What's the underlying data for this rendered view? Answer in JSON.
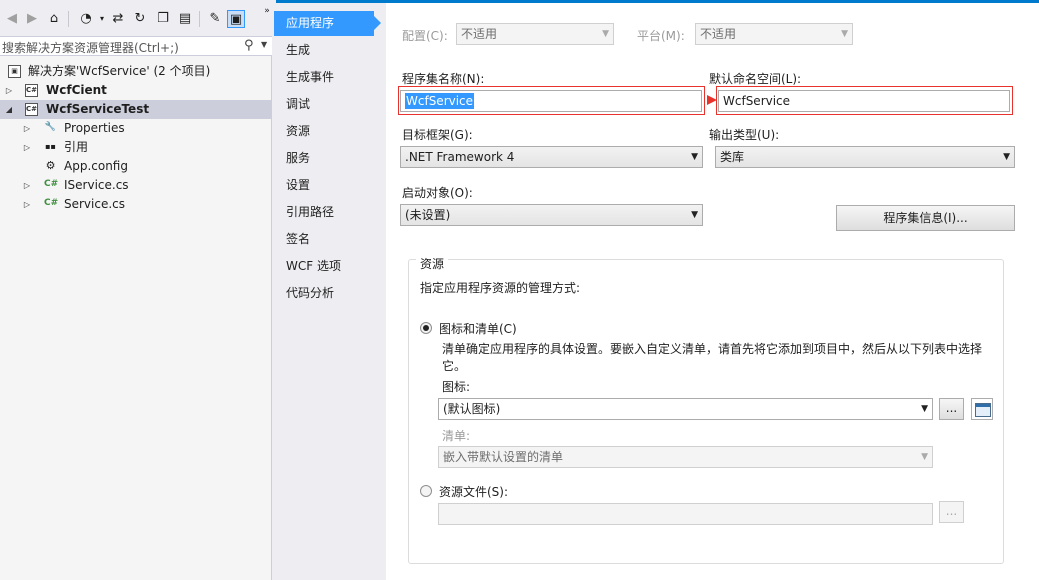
{
  "solution_explorer": {
    "search_placeholder": "搜索解决方案资源管理器(Ctrl+;)",
    "tree": [
      {
        "label": "解决方案'WcfService' (2 个项目)",
        "bold": false
      },
      {
        "label": "WcfCient",
        "bold": true
      },
      {
        "label": "WcfServiceTest",
        "bold": true
      },
      {
        "label": "Properties",
        "bold": false
      },
      {
        "label": "引用",
        "bold": false
      },
      {
        "label": "App.config",
        "bold": false
      },
      {
        "label": "IService.cs",
        "bold": false
      },
      {
        "label": "Service.cs",
        "bold": false
      }
    ]
  },
  "nav": {
    "items": [
      "应用程序",
      "生成",
      "生成事件",
      "调试",
      "资源",
      "服务",
      "设置",
      "引用路径",
      "签名",
      "WCF 选项",
      "代码分析"
    ]
  },
  "props": {
    "config_label": "配置(C):",
    "config_value": "不适用",
    "platform_label": "平台(M):",
    "platform_value": "不适用",
    "assembly_name_label": "程序集名称(N):",
    "assembly_name_value": "WcfService",
    "default_ns_label": "默认命名空间(L):",
    "default_ns_value": "WcfService",
    "target_framework_label": "目标框架(G):",
    "target_framework_value": ".NET Framework 4",
    "output_type_label": "输出类型(U):",
    "output_type_value": "类库",
    "startup_label": "启动对象(O):",
    "startup_value": "(未设置)",
    "assembly_info_button": "程序集信息(I)...",
    "resources": {
      "group_title": "资源",
      "description": "指定应用程序资源的管理方式:",
      "icon_manifest_radio": "图标和清单(C)",
      "icon_manifest_desc_line1": "清单确定应用程序的具体设置。要嵌入自定义清单，请首先将它添加到项目中，然后从以下列表中选择",
      "icon_manifest_desc_line2": "它。",
      "icon_label": "图标:",
      "icon_value": "(默认图标)",
      "browse_button": "...",
      "manifest_label": "清单:",
      "manifest_value": "嵌入带默认设置的清单",
      "resource_file_radio": "资源文件(S):",
      "resource_browse_button": "..."
    }
  },
  "colors": {
    "accent": "#3399ff",
    "highlight_box": "#e8322c",
    "top_line": "#007acc"
  }
}
